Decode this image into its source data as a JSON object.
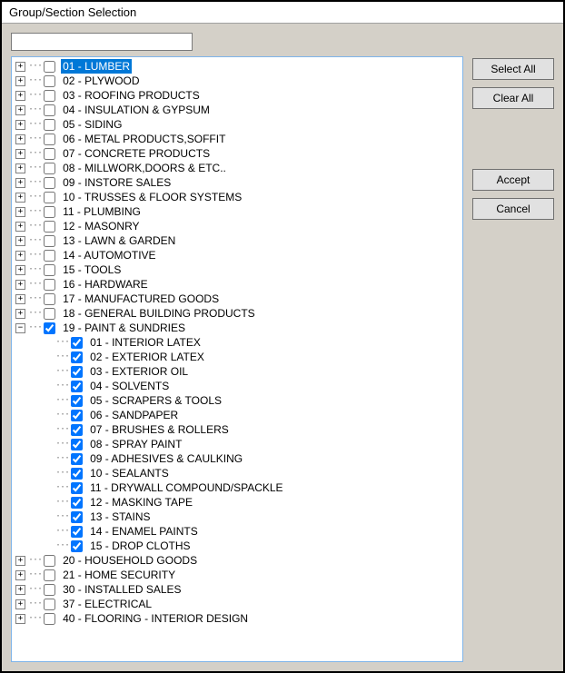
{
  "title": "Group/Section Selection",
  "search_value": "",
  "buttons": {
    "select_all": "Select All",
    "clear_all": "Clear All",
    "accept": "Accept",
    "cancel": "Cancel"
  },
  "tree": [
    {
      "exp": "+",
      "checked": false,
      "label": "01 - LUMBER",
      "selected": true
    },
    {
      "exp": "+",
      "checked": false,
      "label": "02 - PLYWOOD"
    },
    {
      "exp": "+",
      "checked": false,
      "label": "03 - ROOFING PRODUCTS"
    },
    {
      "exp": "+",
      "checked": false,
      "label": "04 - INSULATION & GYPSUM"
    },
    {
      "exp": "+",
      "checked": false,
      "label": "05 - SIDING"
    },
    {
      "exp": "+",
      "checked": false,
      "label": "06 - METAL PRODUCTS,SOFFIT"
    },
    {
      "exp": "+",
      "checked": false,
      "label": "07 - CONCRETE PRODUCTS"
    },
    {
      "exp": "+",
      "checked": false,
      "label": "08 - MILLWORK,DOORS & ETC.."
    },
    {
      "exp": "+",
      "checked": false,
      "label": "09 - INSTORE SALES"
    },
    {
      "exp": "+",
      "checked": false,
      "label": "10 - TRUSSES & FLOOR SYSTEMS"
    },
    {
      "exp": "+",
      "checked": false,
      "label": "11 - PLUMBING"
    },
    {
      "exp": "+",
      "checked": false,
      "label": "12 - MASONRY"
    },
    {
      "exp": "+",
      "checked": false,
      "label": "13 - LAWN & GARDEN"
    },
    {
      "exp": "+",
      "checked": false,
      "label": "14 - AUTOMOTIVE"
    },
    {
      "exp": "+",
      "checked": false,
      "label": "15 - TOOLS"
    },
    {
      "exp": "+",
      "checked": false,
      "label": "16 - HARDWARE"
    },
    {
      "exp": "+",
      "checked": false,
      "label": "17 - MANUFACTURED GOODS"
    },
    {
      "exp": "+",
      "checked": false,
      "label": "18 - GENERAL BUILDING PRODUCTS"
    },
    {
      "exp": "-",
      "checked": true,
      "label": "19 - PAINT & SUNDRIES",
      "children": [
        {
          "checked": true,
          "label": "01 - INTERIOR LATEX"
        },
        {
          "checked": true,
          "label": "02 - EXTERIOR LATEX"
        },
        {
          "checked": true,
          "label": "03 - EXTERIOR OIL"
        },
        {
          "checked": true,
          "label": "04 - SOLVENTS"
        },
        {
          "checked": true,
          "label": "05 - SCRAPERS & TOOLS"
        },
        {
          "checked": true,
          "label": "06 - SANDPAPER"
        },
        {
          "checked": true,
          "label": "07 - BRUSHES & ROLLERS"
        },
        {
          "checked": true,
          "label": "08 - SPRAY PAINT"
        },
        {
          "checked": true,
          "label": "09 - ADHESIVES & CAULKING"
        },
        {
          "checked": true,
          "label": "10 - SEALANTS"
        },
        {
          "checked": true,
          "label": "11 - DRYWALL COMPOUND/SPACKLE"
        },
        {
          "checked": true,
          "label": "12 - MASKING TAPE"
        },
        {
          "checked": true,
          "label": "13 - STAINS"
        },
        {
          "checked": true,
          "label": "14 - ENAMEL PAINTS"
        },
        {
          "checked": true,
          "label": "15 - DROP CLOTHS"
        }
      ]
    },
    {
      "exp": "+",
      "checked": false,
      "label": "20 - HOUSEHOLD GOODS"
    },
    {
      "exp": "+",
      "checked": false,
      "label": "21 - HOME SECURITY"
    },
    {
      "exp": "+",
      "checked": false,
      "label": "30 - INSTALLED SALES"
    },
    {
      "exp": "+",
      "checked": false,
      "label": "37 - ELECTRICAL"
    },
    {
      "exp": "+",
      "checked": false,
      "label": "40 - FLOORING - INTERIOR DESIGN"
    }
  ]
}
